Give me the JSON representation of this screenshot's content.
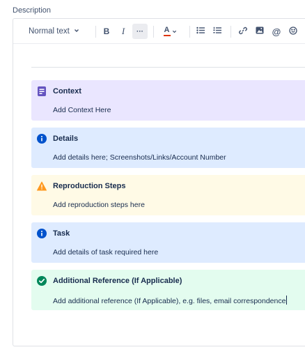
{
  "field_label": "Description",
  "toolbar": {
    "text_style": "Normal text",
    "bold_label": "B",
    "italic_label": "I",
    "more_label": "···",
    "text_color_label": "A",
    "colors": {
      "text_color_underline": "#de350b"
    }
  },
  "panels": [
    {
      "type": "note",
      "icon": "note-icon",
      "title": "Context",
      "body": "Add Context Here",
      "bg": "#eae6ff",
      "icon_color": "#6554c0"
    },
    {
      "type": "info",
      "icon": "info-icon",
      "title": "Details",
      "body": "Add details here; Screenshots/Links/Account Number",
      "bg": "#deebff",
      "icon_color": "#0052cc"
    },
    {
      "type": "warning",
      "icon": "warning-icon",
      "title": "Reproduction Steps",
      "body": "Add reproduction steps here",
      "bg": "#fffae6",
      "icon_color": "#ff991f"
    },
    {
      "type": "info",
      "icon": "info-icon",
      "title": "Task",
      "body": "Add details of task required here",
      "bg": "#deebff",
      "icon_color": "#0052cc"
    },
    {
      "type": "success",
      "icon": "check-circle-icon",
      "title": "Additional Reference (If Applicable)",
      "body": "Add additional reference (If Applicable), e.g. files, email correspondence",
      "bg": "#e3fcef",
      "icon_color": "#00875a"
    }
  ]
}
